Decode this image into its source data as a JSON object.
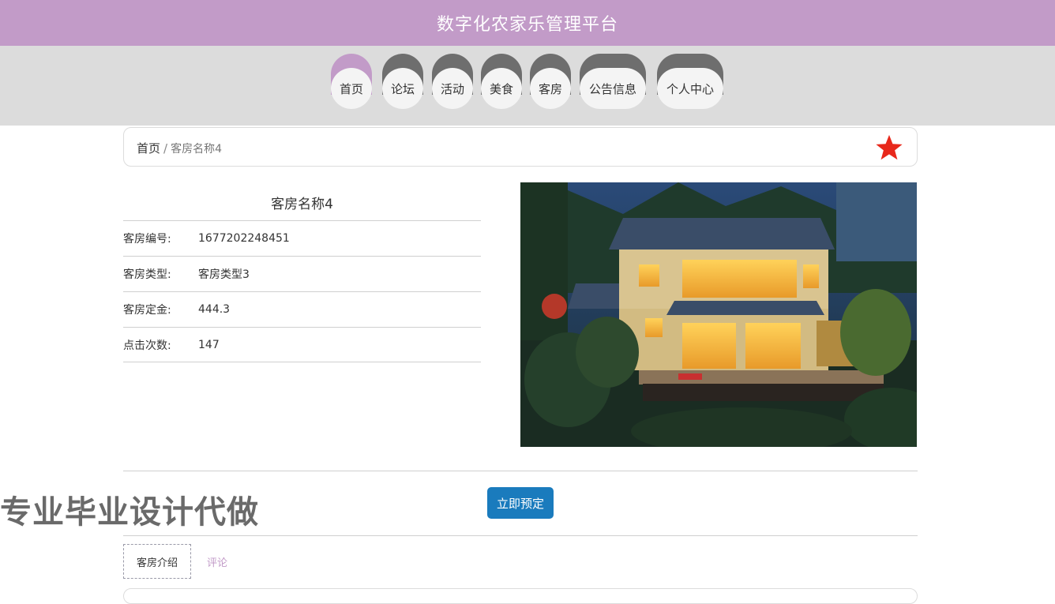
{
  "header": {
    "title": "数字化农家乐管理平台"
  },
  "nav": {
    "items": [
      {
        "label": "首页"
      },
      {
        "label": "论坛"
      },
      {
        "label": "活动"
      },
      {
        "label": "美食"
      },
      {
        "label": "客房"
      },
      {
        "label": "公告信息"
      },
      {
        "label": "个人中心"
      }
    ]
  },
  "breadcrumb": {
    "home": "首页",
    "separator": "/",
    "current": "客房名称4"
  },
  "room": {
    "name": "客房名称4",
    "fields": [
      {
        "label": "客房编号:",
        "value": "1677202248451"
      },
      {
        "label": "客房类型:",
        "value": "客房类型3"
      },
      {
        "label": "客房定金:",
        "value": "444.3"
      },
      {
        "label": "点击次数:",
        "value": "147"
      }
    ]
  },
  "actions": {
    "book_label": "立即预定"
  },
  "watermark": "专业毕业设计代做",
  "tabs": [
    {
      "label": "客房介绍"
    },
    {
      "label": "评论"
    }
  ],
  "colors": {
    "header": "#c29bc8",
    "nav_bg": "#dcdcdc",
    "button": "#1a7bbd",
    "star": "#e8281b"
  },
  "icons": {
    "favorite": "star-icon"
  }
}
